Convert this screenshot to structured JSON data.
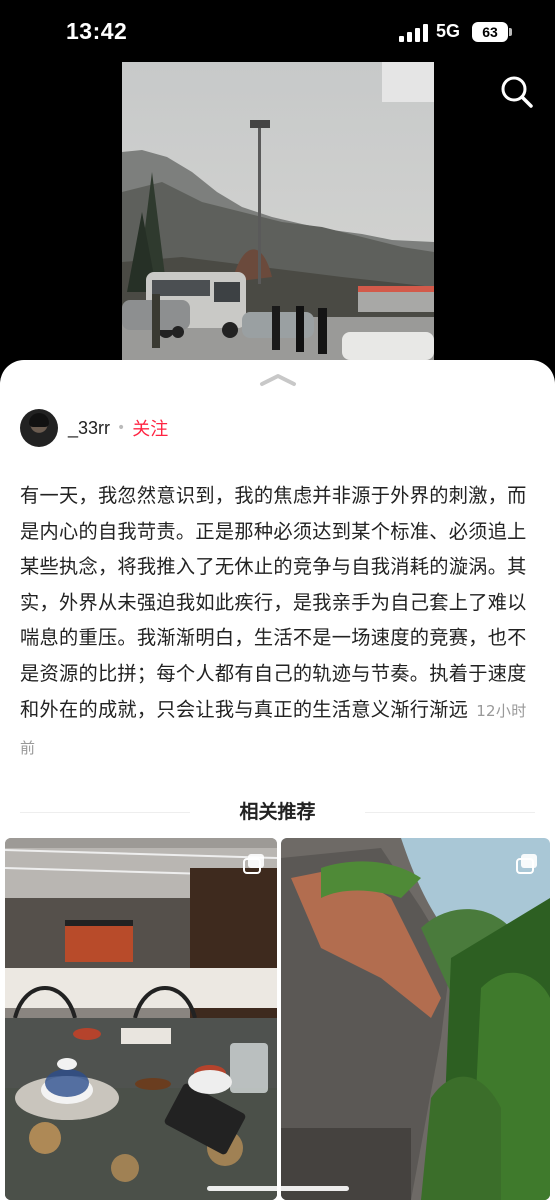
{
  "status_bar": {
    "time": "13:42",
    "network": "5G",
    "battery": "63"
  },
  "post": {
    "author": {
      "name": "_33rr",
      "follow_label": "关注"
    },
    "text": "有一天，我忽然意识到，我的焦虑并非源于外界的刺激，而是内心的自我苛责。正是那种必须达到某个标准、必须追上某些执念，将我推入了无休止的竞争与自我消耗的漩涡。其实，外界从未强迫我如此疾行，是我亲手为自己套上了难以喘息的重压。我渐渐明白，生活不是一场速度的竞赛，也不是资源的比拼；每个人都有自己的轨迹与节奏。执着于速度和外在的成就，只会让我与真正的生活意义渐行渐远",
    "time_ago": "12小时前"
  },
  "related": {
    "title": "相关推荐"
  },
  "icons": {
    "search": "search-icon",
    "collapse": "chevron-up-icon",
    "multi_image": "multi-image-icon"
  },
  "colors": {
    "accent": "#ff2442",
    "background": "#000000",
    "sheet": "#ffffff"
  }
}
